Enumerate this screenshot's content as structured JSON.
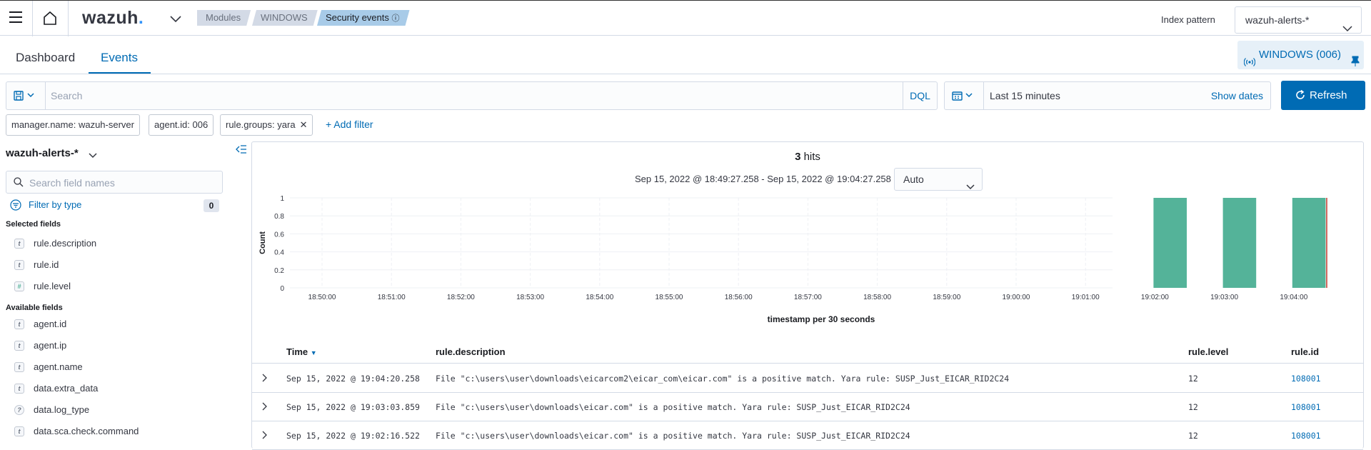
{
  "topbar": {
    "logo_text": "wazuh",
    "logo_dot": ".",
    "breadcrumbs": [
      "Modules",
      "WINDOWS",
      "Security events"
    ],
    "index_pattern_label": "Index pattern",
    "index_pattern_value": "wazuh-alerts-*"
  },
  "tabs": {
    "dashboard": "Dashboard",
    "events": "Events",
    "active": "Events"
  },
  "agent_pill": {
    "label": "WINDOWS (006)"
  },
  "query": {
    "placeholder": "Search",
    "language": "DQL",
    "time_range": "Last 15 minutes",
    "show_dates": "Show dates",
    "refresh": "Refresh"
  },
  "filters": [
    "manager.name: wazuh-server",
    "agent.id: 006",
    "rule.groups: yara"
  ],
  "add_filter": "+ Add filter",
  "sidebar": {
    "index_pattern": "wazuh-alerts-*",
    "search_placeholder": "Search field names",
    "filter_by_type": "Filter by type",
    "filter_count": "0",
    "selected_title": "Selected fields",
    "selected_fields": [
      {
        "name": "rule.description",
        "type": "t"
      },
      {
        "name": "rule.id",
        "type": "t"
      },
      {
        "name": "rule.level",
        "type": "#"
      }
    ],
    "available_title": "Available fields",
    "available_fields": [
      {
        "name": "agent.id",
        "type": "t"
      },
      {
        "name": "agent.ip",
        "type": "t"
      },
      {
        "name": "agent.name",
        "type": "t"
      },
      {
        "name": "data.extra_data",
        "type": "t"
      },
      {
        "name": "data.log_type",
        "type": "?"
      },
      {
        "name": "data.sca.check.command",
        "type": "t"
      }
    ]
  },
  "results": {
    "hits": "3",
    "hits_label": "hits",
    "range": "Sep 15, 2022 @ 18:49:27.258 - Sep 15, 2022 @ 19:04:27.258",
    "interval": "Auto"
  },
  "chart_data": {
    "type": "bar",
    "x_ticks": [
      "18:50:00",
      "18:51:00",
      "18:52:00",
      "18:53:00",
      "18:54:00",
      "18:55:00",
      "18:56:00",
      "18:57:00",
      "18:58:00",
      "18:59:00",
      "19:00:00",
      "19:01:00",
      "19:02:00",
      "19:03:00",
      "19:04:00"
    ],
    "buckets": [
      "19:02:00",
      "19:03:00",
      "19:04:00"
    ],
    "values": [
      1,
      1,
      1
    ],
    "y_ticks": [
      "0",
      "0.2",
      "0.4",
      "0.6",
      "0.8",
      "1"
    ],
    "ylim": [
      0,
      1
    ],
    "ylabel": "Count",
    "xlabel": "timestamp per 30 seconds",
    "bar_color": "#54b399",
    "now_marker_color": "#bd271e"
  },
  "table": {
    "headers": {
      "time": "Time",
      "description": "rule.description",
      "level": "rule.level",
      "id": "rule.id"
    },
    "rows": [
      {
        "time": "Sep 15, 2022 @ 19:04:20.258",
        "description": "File \"c:\\users\\user\\downloads\\eicarcom2\\eicar_com\\eicar.com\" is a positive match. Yara rule: SUSP_Just_EICAR_RID2C24",
        "level": "12",
        "id": "108001"
      },
      {
        "time": "Sep 15, 2022 @ 19:03:03.859",
        "description": "File \"c:\\users\\user\\downloads\\eicar.com\" is a positive match. Yara rule: SUSP_Just_EICAR_RID2C24",
        "level": "12",
        "id": "108001"
      },
      {
        "time": "Sep 15, 2022 @ 19:02:16.522",
        "description": "File \"c:\\users\\user\\downloads\\eicar.com\" is a positive match. Yara rule: SUSP_Just_EICAR_RID2C24",
        "level": "12",
        "id": "108001"
      }
    ]
  }
}
